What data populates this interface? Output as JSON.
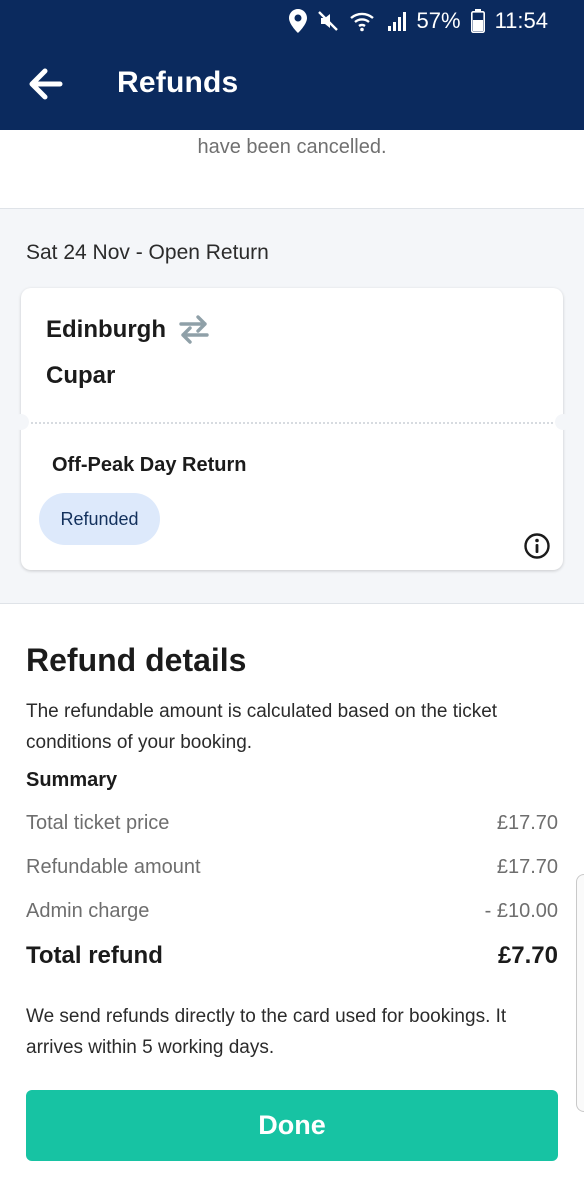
{
  "status_bar": {
    "battery": "57%",
    "time": "11:54"
  },
  "header": {
    "title": "Refunds"
  },
  "snippet_text": "have been cancelled.",
  "journey": {
    "date_line": "Sat 24 Nov - Open Return",
    "from": "Edinburgh",
    "to": "Cupar",
    "ticket_type": "Off-Peak Day Return",
    "status_badge": "Refunded"
  },
  "refund_details": {
    "title": "Refund details",
    "description": "The refundable amount is calculated based on the ticket conditions of your booking.",
    "summary_label": "Summary",
    "rows": [
      {
        "label": "Total ticket price",
        "value": "£17.70"
      },
      {
        "label": "Refundable amount",
        "value": "£17.70"
      },
      {
        "label": "Admin charge",
        "value": "- £10.00"
      }
    ],
    "total": {
      "label": "Total refund",
      "value": "£7.70"
    },
    "note": "We send refunds directly to the card used for bookings. It arrives within 5 working days."
  },
  "done_button": "Done",
  "colors": {
    "header": "#0b2a5e",
    "accent": "#17c3a3",
    "badge_bg": "#dde9fb"
  }
}
